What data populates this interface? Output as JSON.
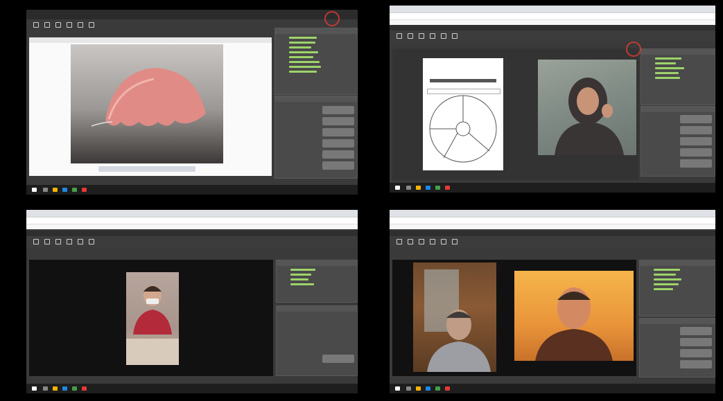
{
  "screens": [
    {
      "id": "top-left",
      "view": "presentation-photo",
      "accent": "#9ed36a"
    },
    {
      "id": "top-right",
      "view": "presentation-slide-and-webcam",
      "accent": "#9ed36a"
    },
    {
      "id": "bottom-left",
      "view": "webcam-single",
      "accent": "#9ed36a"
    },
    {
      "id": "bottom-right",
      "view": "webcam-double",
      "accent": "#9ed36a"
    }
  ],
  "colors": {
    "background": "#000000",
    "app": "#3a3a3a",
    "panel": "#4a4a4a",
    "online_status": "#9ed36a",
    "highlight_ring": "#e53935",
    "slide_bg": "#ffffff",
    "denture": "#e08b86"
  },
  "icons": [
    "pen-tool-icon",
    "pointer-icon",
    "arrow-icon",
    "rectangle-icon",
    "line-icon",
    "eraser-icon",
    "windows-start-icon",
    "taskbar-app-icons"
  ]
}
